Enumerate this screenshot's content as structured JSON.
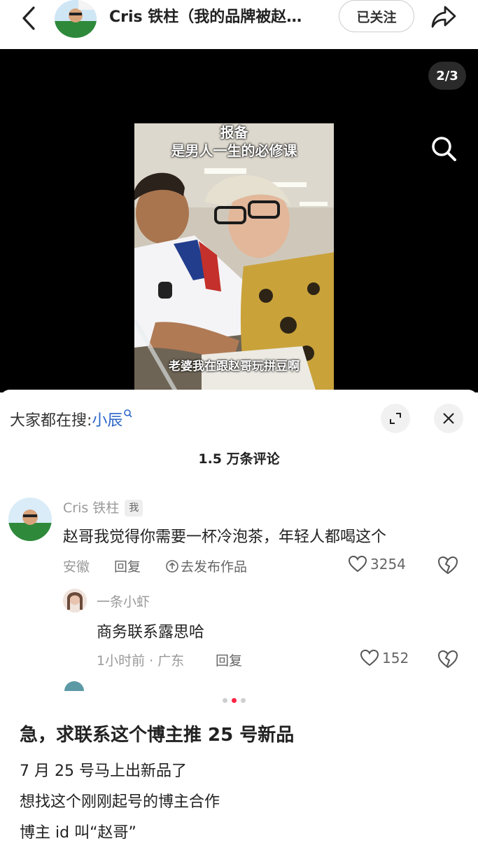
{
  "header": {
    "title": "Cris 铁柱（我的品牌被赵…",
    "follow_label": "已关注"
  },
  "video": {
    "page_indicator": "2/3",
    "caption_top_line1": "报备",
    "caption_top_line2": "是男人一生的必修课",
    "caption_bottom": "老婆我在跟赵哥玩拼豆啊"
  },
  "comments_sheet": {
    "trending_prefix": "大家都在搜:",
    "trending_term": "小辰",
    "count": "1.5 万条评论",
    "comments": [
      {
        "user": "Cris 铁柱",
        "badge": "我",
        "text": "赵哥我觉得你需要一杯冷泡茶，年轻人都喝这个",
        "location": "安徽",
        "reply_label": "回复",
        "publish_label": "去发布作品",
        "likes": "3254",
        "replies": [
          {
            "user": "一条小虾",
            "text": "商务联系露思哈",
            "meta": "1小时前 · 广东",
            "reply_label": "回复",
            "likes": "152"
          }
        ]
      }
    ]
  },
  "carousel": {
    "total": 3,
    "active": 2
  },
  "post": {
    "title": "急，求联系这个博主推 25 号新品",
    "lines": [
      "7 月 25 号马上出新品了",
      "想找这个刚刚起号的博主合作",
      "博主 id 叫“赵哥”"
    ]
  },
  "colors": {
    "accent_red": "#ff2442",
    "link_blue": "#2a64c8"
  }
}
